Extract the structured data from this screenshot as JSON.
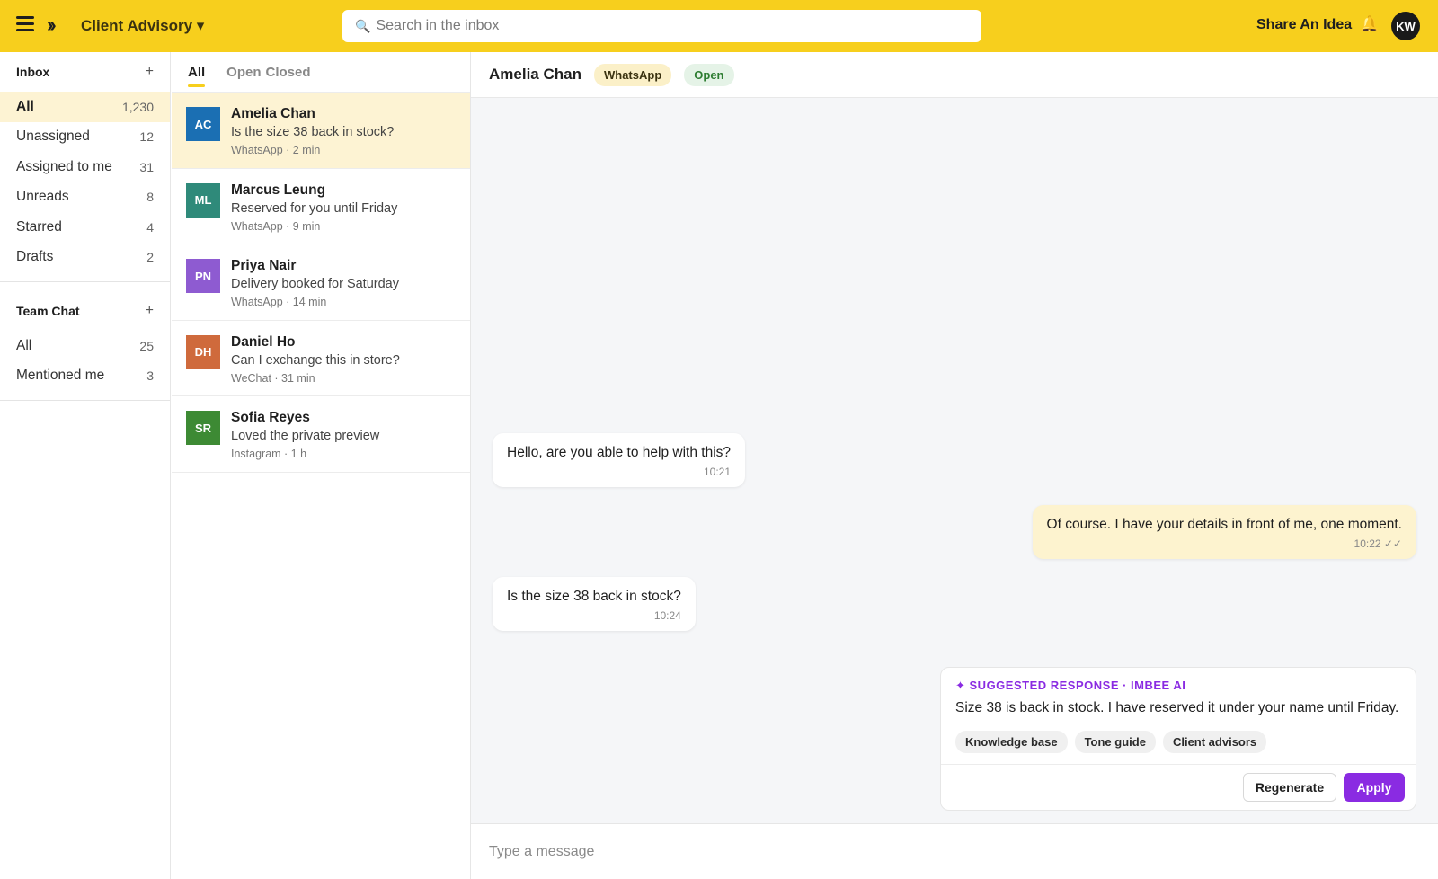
{
  "topbar": {
    "workspace": "Client Advisory ▾",
    "search_placeholder": "Search in the inbox",
    "share_label": "Share An Idea",
    "avatar_initials": "KW"
  },
  "sidebar": {
    "inbox_title": "Inbox",
    "inbox_items": [
      {
        "label": "All",
        "count": "1,230"
      },
      {
        "label": "Unassigned",
        "count": "12"
      },
      {
        "label": "Assigned to me",
        "count": "31"
      },
      {
        "label": "Unreads",
        "count": "8"
      },
      {
        "label": "Starred",
        "count": "4"
      },
      {
        "label": "Drafts",
        "count": "2"
      }
    ],
    "team_title": "Team Chat",
    "team_items": [
      {
        "label": "All",
        "count": "25"
      },
      {
        "label": "Mentioned me",
        "count": "3"
      }
    ],
    "plus": "+"
  },
  "conversation_list": {
    "tabs": [
      "All",
      "Open",
      "Closed"
    ],
    "conversations": [
      {
        "initials": "AC",
        "name": "Amelia Chan",
        "preview": "Is the size 38 back in stock?",
        "meta": "WhatsApp · 2 min",
        "color": "#1b6fb3"
      },
      {
        "initials": "ML",
        "name": "Marcus Leung",
        "preview": "Reserved for you until Friday",
        "meta": "WhatsApp · 9 min",
        "color": "#2f8a7a"
      },
      {
        "initials": "PN",
        "name": "Priya Nair",
        "preview": "Delivery booked for Saturday",
        "meta": "WhatsApp · 14 min",
        "color": "#8e5bd1"
      },
      {
        "initials": "DH",
        "name": "Daniel Ho",
        "preview": "Can I exchange this in store?",
        "meta": "WeChat · 31 min",
        "color": "#cf6a3c"
      },
      {
        "initials": "SR",
        "name": "Sofia Reyes",
        "preview": "Loved the private preview",
        "meta": "Instagram · 1 h",
        "color": "#3d8a34"
      }
    ]
  },
  "chat": {
    "contact_name": "Amelia Chan",
    "channel": "WhatsApp",
    "status": "Open",
    "messages": [
      {
        "text": "Hello, are you able to help with this?",
        "time": "10:21"
      },
      {
        "text": "Of course. I have your details in front of me, one moment.",
        "time": "10:22 ✓✓"
      },
      {
        "text": "Is the size 38 back in stock?",
        "time": "10:24"
      }
    ],
    "suggestion": {
      "label": "✦ SUGGESTED RESPONSE · IMBEE AI",
      "text": "Size 38 is back in stock. I have reserved it under your name until Friday.",
      "chips": [
        "Knowledge base",
        "Tone guide",
        "Client advisors"
      ],
      "regenerate": "Regenerate",
      "apply": "Apply"
    },
    "composer_placeholder": "Type a message"
  },
  "colors": {
    "brand_yellow": "#f7cf1d",
    "accent_purple": "#8a2be2",
    "active_row": "#fdf3d3"
  }
}
